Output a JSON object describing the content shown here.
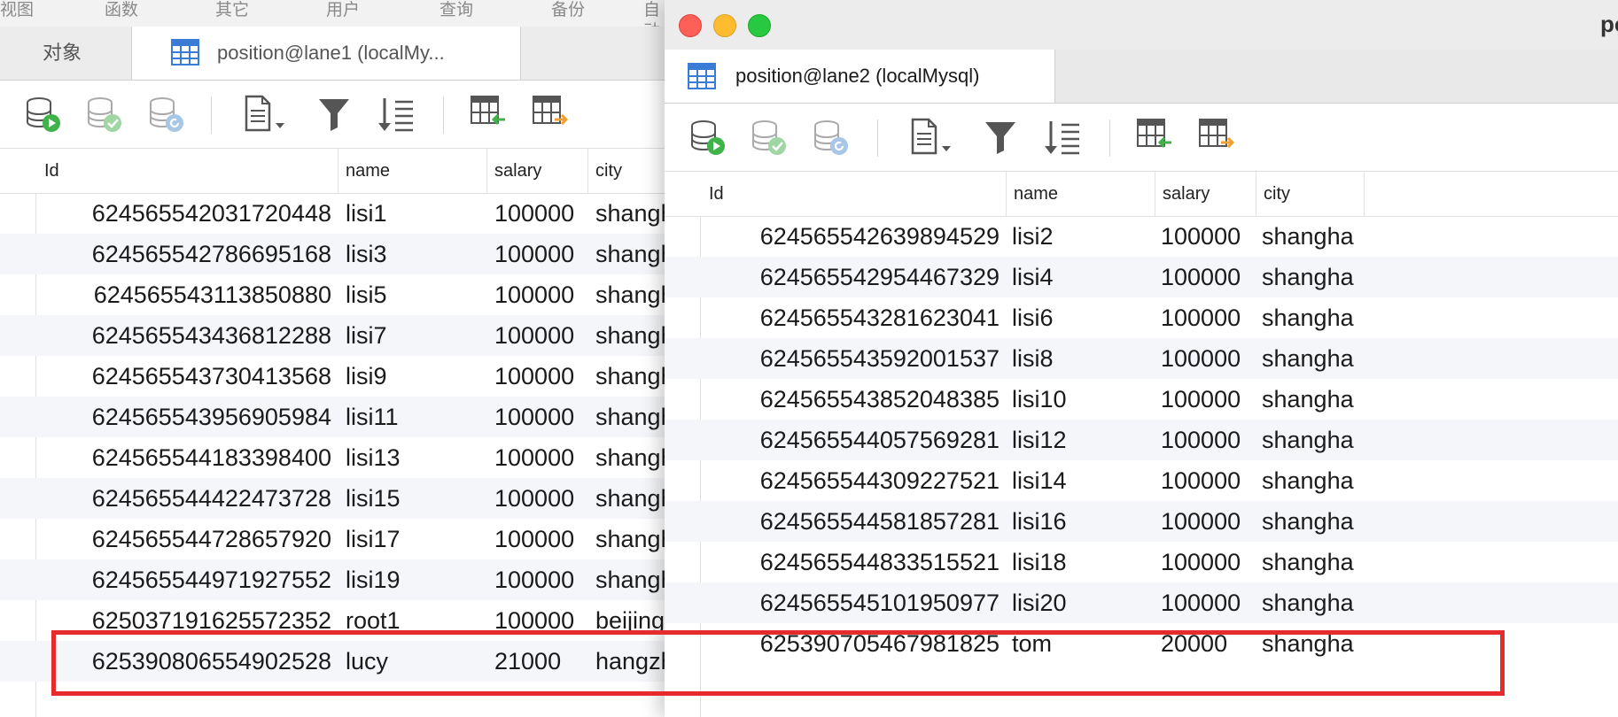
{
  "left_window": {
    "menu": [
      "视图",
      "函数",
      "其它",
      "用户",
      "查询",
      "备份",
      "自动"
    ],
    "tabs": {
      "objects": "对象",
      "table": "position@lane1 (localMy..."
    },
    "columns": [
      "Id",
      "name",
      "salary",
      "city"
    ],
    "rows": [
      {
        "id": "624565542031720448",
        "name": "lisi1",
        "salary": "100000",
        "city": "shanghai"
      },
      {
        "id": "624565542786695168",
        "name": "lisi3",
        "salary": "100000",
        "city": "shanghai"
      },
      {
        "id": "624565543113850880",
        "name": "lisi5",
        "salary": "100000",
        "city": "shanghai"
      },
      {
        "id": "624565543436812288",
        "name": "lisi7",
        "salary": "100000",
        "city": "shanghai"
      },
      {
        "id": "624565543730413568",
        "name": "lisi9",
        "salary": "100000",
        "city": "shanghai"
      },
      {
        "id": "624565543956905984",
        "name": "lisi11",
        "salary": "100000",
        "city": "shanghai"
      },
      {
        "id": "624565544183398400",
        "name": "lisi13",
        "salary": "100000",
        "city": "shanghai"
      },
      {
        "id": "624565544422473728",
        "name": "lisi15",
        "salary": "100000",
        "city": "shanghai"
      },
      {
        "id": "624565544728657920",
        "name": "lisi17",
        "salary": "100000",
        "city": "shanghai"
      },
      {
        "id": "624565544971927552",
        "name": "lisi19",
        "salary": "100000",
        "city": "shanghai"
      },
      {
        "id": "625037191625572352",
        "name": "root1",
        "salary": "100000",
        "city": "beijing"
      },
      {
        "id": "625390806554902528",
        "name": "lucy",
        "salary": "21000",
        "city": "hangzhou"
      }
    ]
  },
  "right_window": {
    "title_fragment": "po",
    "tab": "position@lane2 (localMysql)",
    "columns": [
      "Id",
      "name",
      "salary",
      "city"
    ],
    "rows": [
      {
        "id": "624565542639894529",
        "name": "lisi2",
        "salary": "100000",
        "city": "shanghai"
      },
      {
        "id": "624565542954467329",
        "name": "lisi4",
        "salary": "100000",
        "city": "shanghai"
      },
      {
        "id": "624565543281623041",
        "name": "lisi6",
        "salary": "100000",
        "city": "shanghai"
      },
      {
        "id": "624565543592001537",
        "name": "lisi8",
        "salary": "100000",
        "city": "shanghai"
      },
      {
        "id": "624565543852048385",
        "name": "lisi10",
        "salary": "100000",
        "city": "shanghai"
      },
      {
        "id": "624565544057569281",
        "name": "lisi12",
        "salary": "100000",
        "city": "shanghai"
      },
      {
        "id": "624565544309227521",
        "name": "lisi14",
        "salary": "100000",
        "city": "shanghai"
      },
      {
        "id": "624565544581857281",
        "name": "lisi16",
        "salary": "100000",
        "city": "shanghai"
      },
      {
        "id": "624565544833515521",
        "name": "lisi18",
        "salary": "100000",
        "city": "shanghai"
      },
      {
        "id": "624565545101950977",
        "name": "lisi20",
        "salary": "100000",
        "city": "shanghai"
      },
      {
        "id": "625390705467981825",
        "name": "tom",
        "salary": "20000",
        "city": "shanghai"
      }
    ]
  },
  "toolbar_icons": [
    "run-query-icon",
    "commit-icon",
    "refresh-icon",
    "text-view-icon",
    "filter-icon",
    "sort-icon",
    "import-icon",
    "export-icon"
  ],
  "colors": {
    "highlight": "#e52b2b",
    "row_alt": "#f4f6f9",
    "close": "#fe5f57",
    "minimize": "#febc2e",
    "zoom": "#28c840",
    "table_icon": "#3a7bd5"
  }
}
